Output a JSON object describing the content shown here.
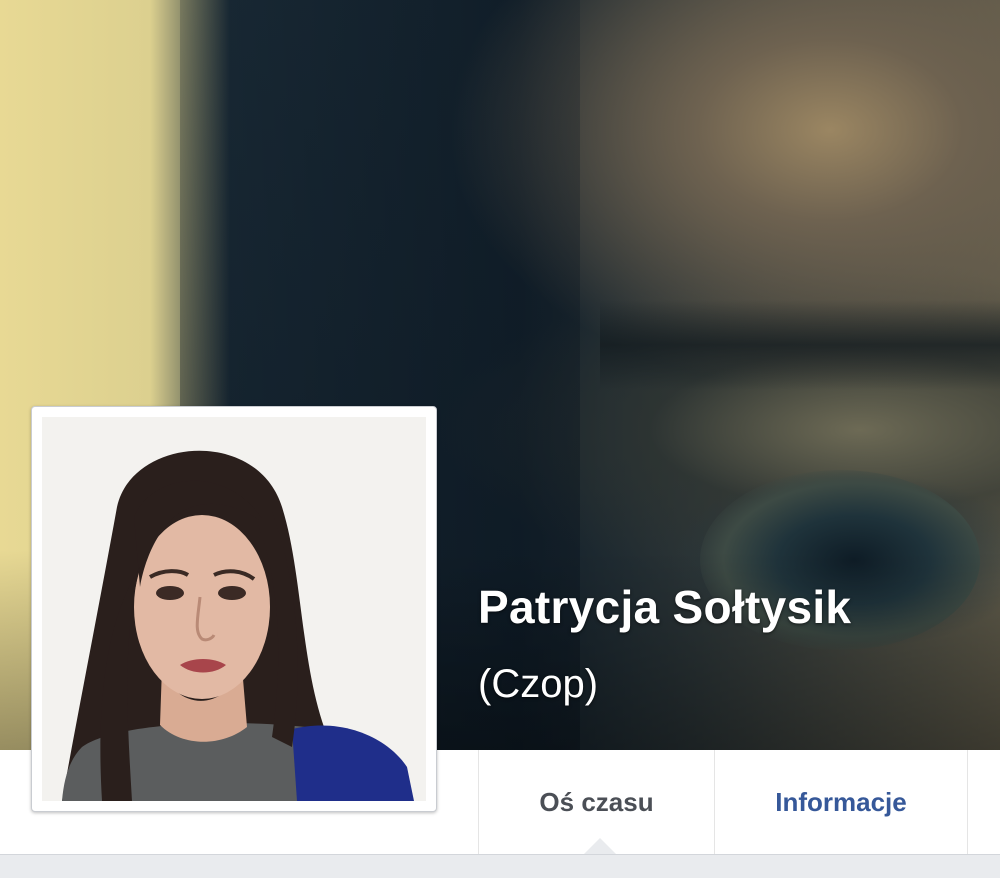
{
  "profile": {
    "name": "Patrycja Sołtysik",
    "alternate_name": "(Czop)",
    "avatar_icon": "profile-photo",
    "cover_icon": "cover-photo"
  },
  "tabs": [
    {
      "label": "Oś czasu",
      "active": true
    },
    {
      "label": "Informacje",
      "active": false
    }
  ],
  "colors": {
    "link": "#365899",
    "active_tab_text": "#4b4f56",
    "page_background": "#e9ebee"
  }
}
